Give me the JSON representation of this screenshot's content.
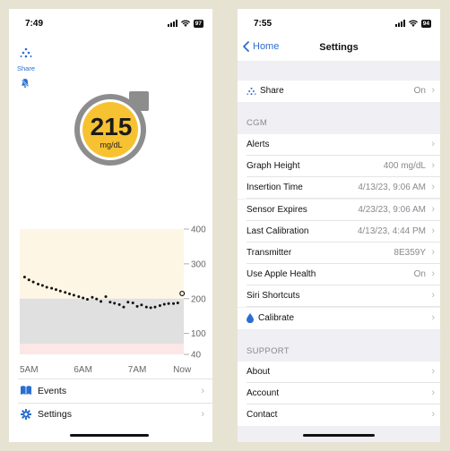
{
  "left_screen": {
    "status": {
      "time": "7:49",
      "battery": "97"
    },
    "share_label": "Share",
    "reading": {
      "value": "215",
      "unit": "mg/dL"
    },
    "chart_data": {
      "type": "scatter",
      "x_ticks": [
        "5AM",
        "6AM",
        "7AM",
        "Now"
      ],
      "y_ticks": [
        "400",
        "300",
        "200",
        "100",
        "40"
      ],
      "ylim": [
        40,
        400
      ],
      "zones": {
        "high": [
          200,
          400
        ],
        "target": [
          70,
          200
        ],
        "low": [
          40,
          70
        ]
      },
      "x_hours": [
        4.92,
        5.0,
        5.08,
        5.17,
        5.25,
        5.33,
        5.42,
        5.5,
        5.58,
        5.67,
        5.75,
        5.83,
        5.92,
        6.0,
        6.08,
        6.17,
        6.25,
        6.33,
        6.42,
        6.5,
        6.58,
        6.67,
        6.75,
        6.83,
        6.92,
        7.0,
        7.08,
        7.17,
        7.25,
        7.33,
        7.42,
        7.5,
        7.58,
        7.67,
        7.75
      ],
      "values": [
        262,
        254,
        248,
        242,
        238,
        233,
        230,
        226,
        222,
        218,
        214,
        210,
        206,
        202,
        198,
        204,
        199,
        192,
        206,
        190,
        187,
        183,
        176,
        190,
        188,
        178,
        182,
        176,
        174,
        176,
        180,
        184,
        186,
        186,
        188
      ],
      "current_point": {
        "x_hour": 7.83,
        "value": 215
      }
    },
    "menu": [
      {
        "label": "Events",
        "icon": "book-icon"
      },
      {
        "label": "Settings",
        "icon": "gear-icon"
      }
    ]
  },
  "right_screen": {
    "status": {
      "time": "7:55",
      "battery": "94"
    },
    "nav": {
      "back_label": "Home",
      "title": "Settings"
    },
    "share_row": {
      "label": "Share",
      "value": "On"
    },
    "cgm_header": "CGM",
    "cgm_rows": [
      {
        "label": "Alerts",
        "value": ""
      },
      {
        "label": "Graph Height",
        "value": "400 mg/dL"
      },
      {
        "label": "Insertion Time",
        "value": "4/13/23, 9:06 AM"
      },
      {
        "label": "Sensor Expires",
        "value": "4/23/23, 9:06 AM"
      },
      {
        "label": "Last Calibration",
        "value": "4/13/23, 4:44 PM"
      },
      {
        "label": "Transmitter",
        "value": "8E359Y"
      },
      {
        "label": "Use Apple Health",
        "value": "On"
      },
      {
        "label": "Siri Shortcuts",
        "value": ""
      },
      {
        "label": "Calibrate",
        "value": ""
      }
    ],
    "support_header": "SUPPORT",
    "support_rows": [
      {
        "label": "About"
      },
      {
        "label": "Account"
      },
      {
        "label": "Contact"
      }
    ]
  },
  "colors": {
    "accent": "#2a6fd0",
    "gauge_yellow": "#f7c231",
    "gauge_ring": "#8d8d8d",
    "high_zone": "#fdf6e4",
    "target_zone": "#e0e0e0",
    "low_zone": "#fde6e6"
  }
}
